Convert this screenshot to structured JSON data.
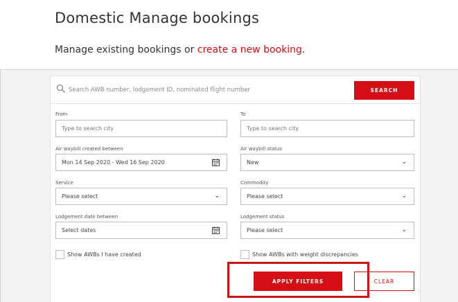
{
  "header": {
    "title": "Domestic Manage bookings",
    "subtitle_prefix": "Manage existing bookings or ",
    "subtitle_link": "create a new booking",
    "subtitle_suffix": "."
  },
  "search": {
    "placeholder": "Search AWB number, lodgement ID, nominated flight number",
    "button_label": "SEARCH"
  },
  "filters": {
    "from": {
      "label": "From",
      "placeholder": "Type to search city"
    },
    "to": {
      "label": "To",
      "placeholder": "Type to search city"
    },
    "awb_created": {
      "label": "Air waybill created between",
      "value": "Mon 14 Sep 2020 - Wed 16 Sep 2020"
    },
    "awb_status": {
      "label": "Air waybill status",
      "value": "New"
    },
    "service": {
      "label": "Service",
      "value": "Please select"
    },
    "commodity": {
      "label": "Commodity",
      "value": "Please select"
    },
    "lodgement_date": {
      "label": "Lodgement date between",
      "value": "Select dates"
    },
    "lodgement_status": {
      "label": "Lodgement status",
      "value": "Please select"
    },
    "show_mine": {
      "label": "Show AWBs I have created"
    },
    "show_weight": {
      "label": "Show AWBs with weight discrepancies"
    }
  },
  "actions": {
    "apply_label": "APPLY FILTERS",
    "clear_label": "CLEAR"
  },
  "colors": {
    "accent": "#d40e14",
    "highlight": "#c8161b"
  },
  "icons": {
    "search": "search-icon",
    "calendar": "calendar-icon",
    "chevron": "chevron-down-icon"
  }
}
